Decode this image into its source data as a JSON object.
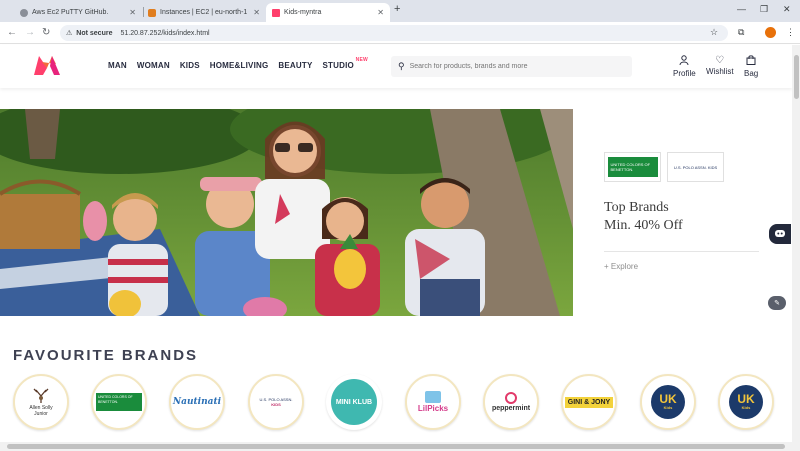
{
  "browser": {
    "tabs": [
      {
        "title": "Aws Ec2 PuTTY GitHub.",
        "active": false
      },
      {
        "title": "Instances | EC2 | eu-north-1",
        "active": false
      },
      {
        "title": "Kids-myntra",
        "active": true
      }
    ],
    "new_tab": "+",
    "security_label": "Not secure",
    "url": "51.20.87.252/kids/index.html"
  },
  "header": {
    "nav": [
      "MAN",
      "WOMAN",
      "KIDS",
      "HOME&LIVING",
      "BEAUTY",
      "STUDIO"
    ],
    "studio_badge": "NEW",
    "search_placeholder": "Search for products, brands and more",
    "actions": {
      "profile": "Profile",
      "wishlist": "Wishlist",
      "bag": "Bag"
    }
  },
  "banner": {
    "brands": [
      "UNITED COLORS OF BENETTON.",
      "U.S. POLO ASSN. KIDS"
    ],
    "headline_1": "Top Brands",
    "headline_2": "Min. 40% Off",
    "cta": "+ Explore"
  },
  "favourite": {
    "title": "FAVOURITE BRANDS",
    "brands": [
      {
        "name": "Allen Solly",
        "sub": "Junior"
      },
      {
        "name": "UNITED COLORS OF BENETTON."
      },
      {
        "name": "Nautinati"
      },
      {
        "name": "U.S. POLO ASSN.",
        "sub": "KIDS"
      },
      {
        "name": "MINI KLUB"
      },
      {
        "name": "LilPicks"
      },
      {
        "name": "peppermint"
      },
      {
        "name": "GINI & JONY"
      },
      {
        "name": "UK",
        "sub": "Kids"
      },
      {
        "name": "UK",
        "sub": "Kids"
      }
    ]
  },
  "colors": {
    "accent": "#ff3f6c",
    "benetton_green": "#1a8c3c",
    "chat": "#23293b"
  }
}
